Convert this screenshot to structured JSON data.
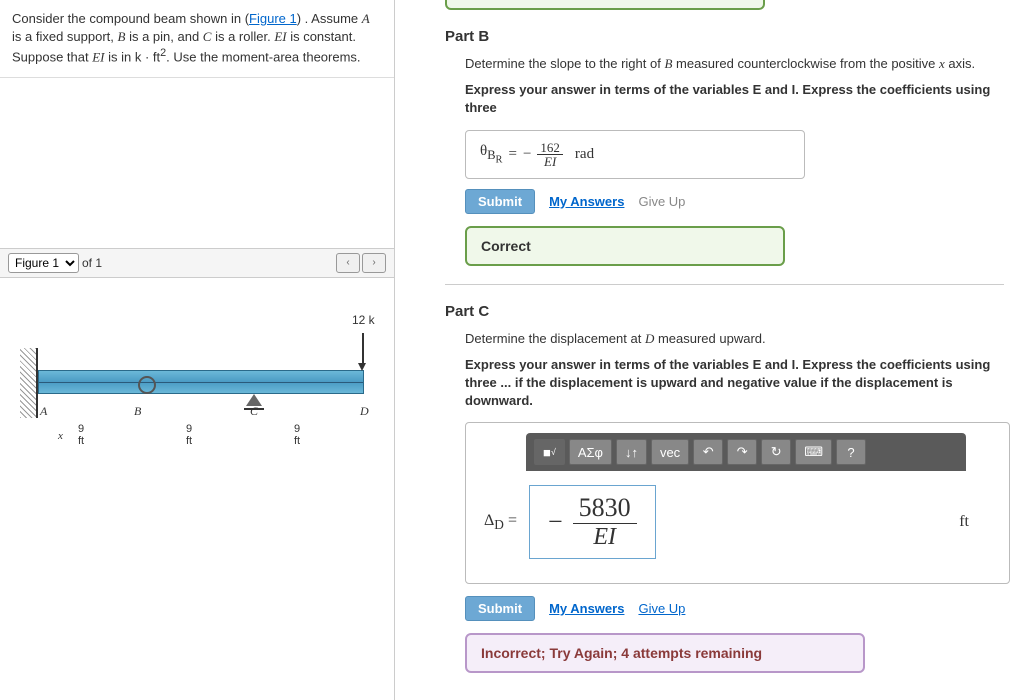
{
  "left": {
    "problem_html": "Consider the compound beam shown in (",
    "figure_link": "Figure 1",
    "problem_tail": ") . Assume ",
    "p2": " is a fixed support, ",
    "p3": " is a pin, and ",
    "p4": " is a roller. ",
    "p5": " is constant. Suppose that ",
    "p6": " is in k · ft",
    "p7": ". Use the moment-area theorems.",
    "A": "A",
    "B": "B",
    "C": "C",
    "EI": "EI",
    "figure_sel": "Figure 1",
    "of1": "of 1",
    "load": "12 k",
    "la": "A",
    "lb": "B",
    "lc": "C",
    "ld": "D",
    "lx": "x",
    "d9": "9 ft"
  },
  "partB": {
    "title": "Part B",
    "instr": "Determine the slope to the right of ",
    "instrB": "B",
    "instr2": " measured counterclockwise from the positive ",
    "instrX": "x",
    "instr3": " axis.",
    "bold": "Express your answer in terms of the variables ",
    "boldE": "E",
    "boldAnd": " and ",
    "boldI": "I",
    "bold2": ". Express the coefficients using three",
    "theta": "θ",
    "sub": "B",
    "subR": "R",
    "eq": " = ",
    "minus": "−",
    "num": "162",
    "den": "EI",
    "unit": "rad",
    "submit": "Submit",
    "myans": "My Answers",
    "giveup": "Give Up",
    "correct": "Correct"
  },
  "partC": {
    "title": "Part C",
    "instr": "Determine the displacement at ",
    "instrD": "D",
    "instr2": " measured upward.",
    "bold": "Express your answer in terms of the variables ",
    "boldE": "E",
    "boldAnd": " and ",
    "boldI": "I",
    "bold2": ". Express the coefficients using three ... if the displacement is upward and negative value if the displacement is downward.",
    "tool1": "■",
    "tool2": "√",
    "tool3": "ΑΣφ",
    "tool4": "↓↑",
    "tool5": "vec",
    "tool6": "↶",
    "tool7": "↷",
    "tool8": "↻",
    "tool9": "⌨",
    "tool10": "?",
    "delta": "Δ",
    "deltaSub": "D",
    "eq": " = ",
    "minus": "−",
    "num": "5830",
    "den": "EI",
    "unit": "ft",
    "submit": "Submit",
    "myans": "My Answers",
    "giveup": "Give Up",
    "incorrect": "Incorrect; Try Again; 4 attempts remaining"
  }
}
